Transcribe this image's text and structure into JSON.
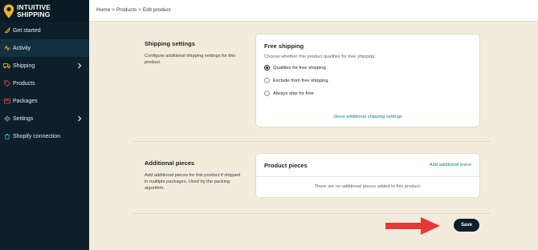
{
  "brand": {
    "name_line1": "INTUITIVE",
    "name_line2": "SHIPPING",
    "accent": "#f0b429"
  },
  "sidebar": {
    "items": [
      {
        "label": "Get started",
        "icon": "rocket-icon"
      },
      {
        "label": "Activity",
        "icon": "activity-icon"
      },
      {
        "label": "Shipping",
        "icon": "truck-icon",
        "has_children": true
      },
      {
        "label": "Products",
        "icon": "tag-icon"
      },
      {
        "label": "Packages",
        "icon": "package-icon"
      },
      {
        "label": "Settings",
        "icon": "gear-icon",
        "has_children": true
      },
      {
        "label": "Shopify connection",
        "icon": "shopify-icon"
      }
    ],
    "active_index": 1
  },
  "breadcrumb": {
    "home": "Home",
    "products": "Products",
    "current": "Edit product",
    "separator": ">"
  },
  "shipping_settings": {
    "title": "Shipping settings",
    "description": "Configure additional shipping settings for this product.",
    "card": {
      "title": "Free shipping",
      "subtitle": "Choose whether this product qualifies for free shipping.",
      "options": [
        {
          "label": "Qualifies for free shipping",
          "checked": true
        },
        {
          "label": "Exclude from free shipping",
          "checked": false
        },
        {
          "label": "Always ship for free",
          "checked": false
        }
      ],
      "link": "Show additional shipping settings"
    }
  },
  "additional_pieces": {
    "title": "Additional pieces",
    "description": "Add additional pieces for this product if shipped in multiple packages. Used by the packing algorithm.",
    "card": {
      "title": "Product pieces",
      "add_link": "Add additional piece",
      "empty_text": "There are no additional pieces added to this product."
    }
  },
  "footer": {
    "save_label": "Save"
  },
  "colors": {
    "sidebar_bg": "#0c1f2b",
    "page_bg": "#f3ebdb",
    "link": "#1d7a8e",
    "arrow": "#e53935"
  }
}
